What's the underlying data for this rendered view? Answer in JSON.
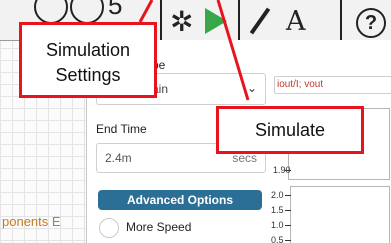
{
  "toolbar": {
    "partial_glyph": "5",
    "text_tool_letter": "A",
    "help_symbol": "?",
    "icons": [
      "circle-icon",
      "circle-icon",
      "gear-icon",
      "play-icon",
      "pencil-icon",
      "text-icon",
      "help-icon"
    ],
    "play_color": "#3aa64a"
  },
  "settings_panel": {
    "type_label_partial": "pe",
    "type_value_partial": "ain",
    "end_time_label": "End Time",
    "end_time_value": "2.4m",
    "end_time_unit": "secs",
    "advanced_button": "Advanced Options",
    "advanced_button_color": "#2c6f96",
    "more_speed_label": "More Speed"
  },
  "plot": {
    "expression_partial": "iout/I; vout",
    "top_tick_partial": "1.90",
    "ticks": [
      "2.0",
      "1.5",
      "1.0",
      "0.5"
    ]
  },
  "sidebar": {
    "partial_text": "ponents E"
  },
  "callouts": {
    "simulation_settings_line1": "Simulation",
    "simulation_settings_line2": "Settings",
    "simulate": "Simulate",
    "border_color": "#e8141b"
  }
}
